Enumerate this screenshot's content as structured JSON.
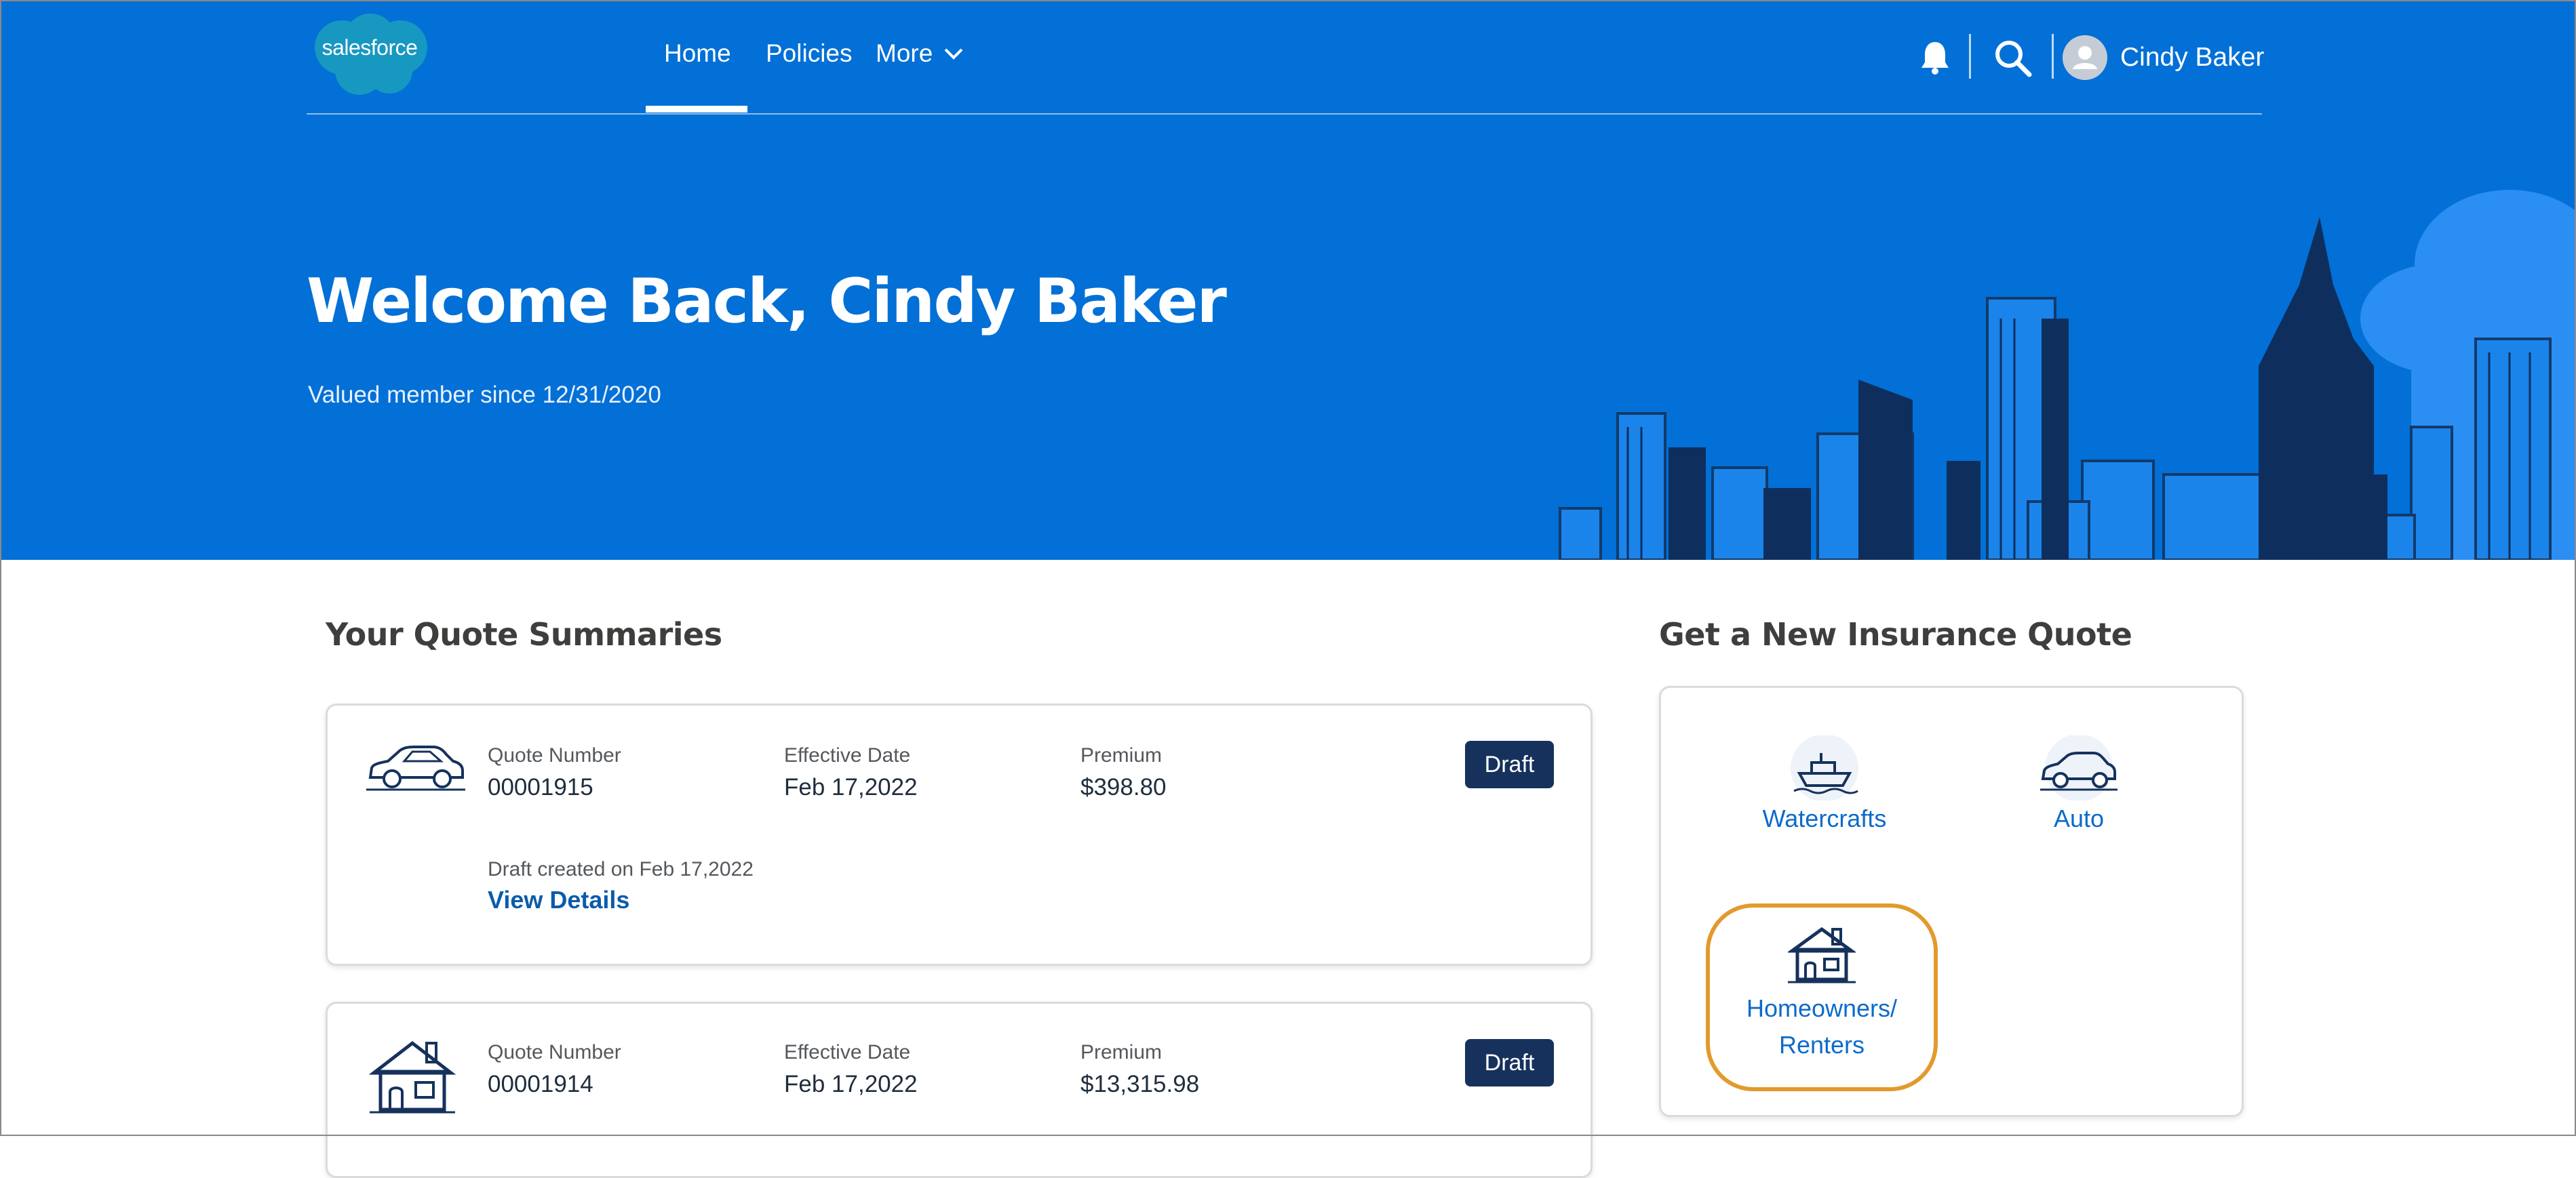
{
  "brand": {
    "logo_text": "salesforce",
    "colors": {
      "hero": "#0270d6",
      "navy": "#16325c",
      "link": "#0b5cab",
      "highlight": "#e39a2d"
    }
  },
  "nav": {
    "home": "Home",
    "policies": "Policies",
    "more": "More",
    "more_icon": "chevron-down-icon",
    "notifications_icon": "bell-icon",
    "search_icon": "search-icon",
    "user_name": "Cindy Baker"
  },
  "hero": {
    "title": "Welcome Back, Cindy Baker",
    "member_since": "Valued member since 12/31/2020"
  },
  "quotes": {
    "title": "Your Quote Summaries",
    "items": [
      {
        "icon": "car-icon",
        "quote_number_label": "Quote Number",
        "quote_number": "00001915",
        "effective_date_label": "Effective Date",
        "effective_date": "Feb 17,2022",
        "premium_label": "Premium",
        "premium": "$398.80",
        "status": "Draft",
        "created": "Draft created on Feb 17,2022",
        "details_link": "View Details"
      },
      {
        "icon": "house-icon",
        "quote_number_label": "Quote Number",
        "quote_number": "00001914",
        "effective_date_label": "Effective Date",
        "effective_date": "Feb 17,2022",
        "premium_label": "Premium",
        "premium": "$13,315.98",
        "status": "Draft"
      }
    ]
  },
  "new_quote": {
    "title": "Get a New Insurance Quote",
    "options": [
      {
        "label": "Watercrafts",
        "icon": "boat-icon"
      },
      {
        "label": "Auto",
        "icon": "car-icon"
      },
      {
        "label_line1": "Homeowners/",
        "label_line2": "Renters",
        "icon": "house-icon"
      }
    ]
  }
}
